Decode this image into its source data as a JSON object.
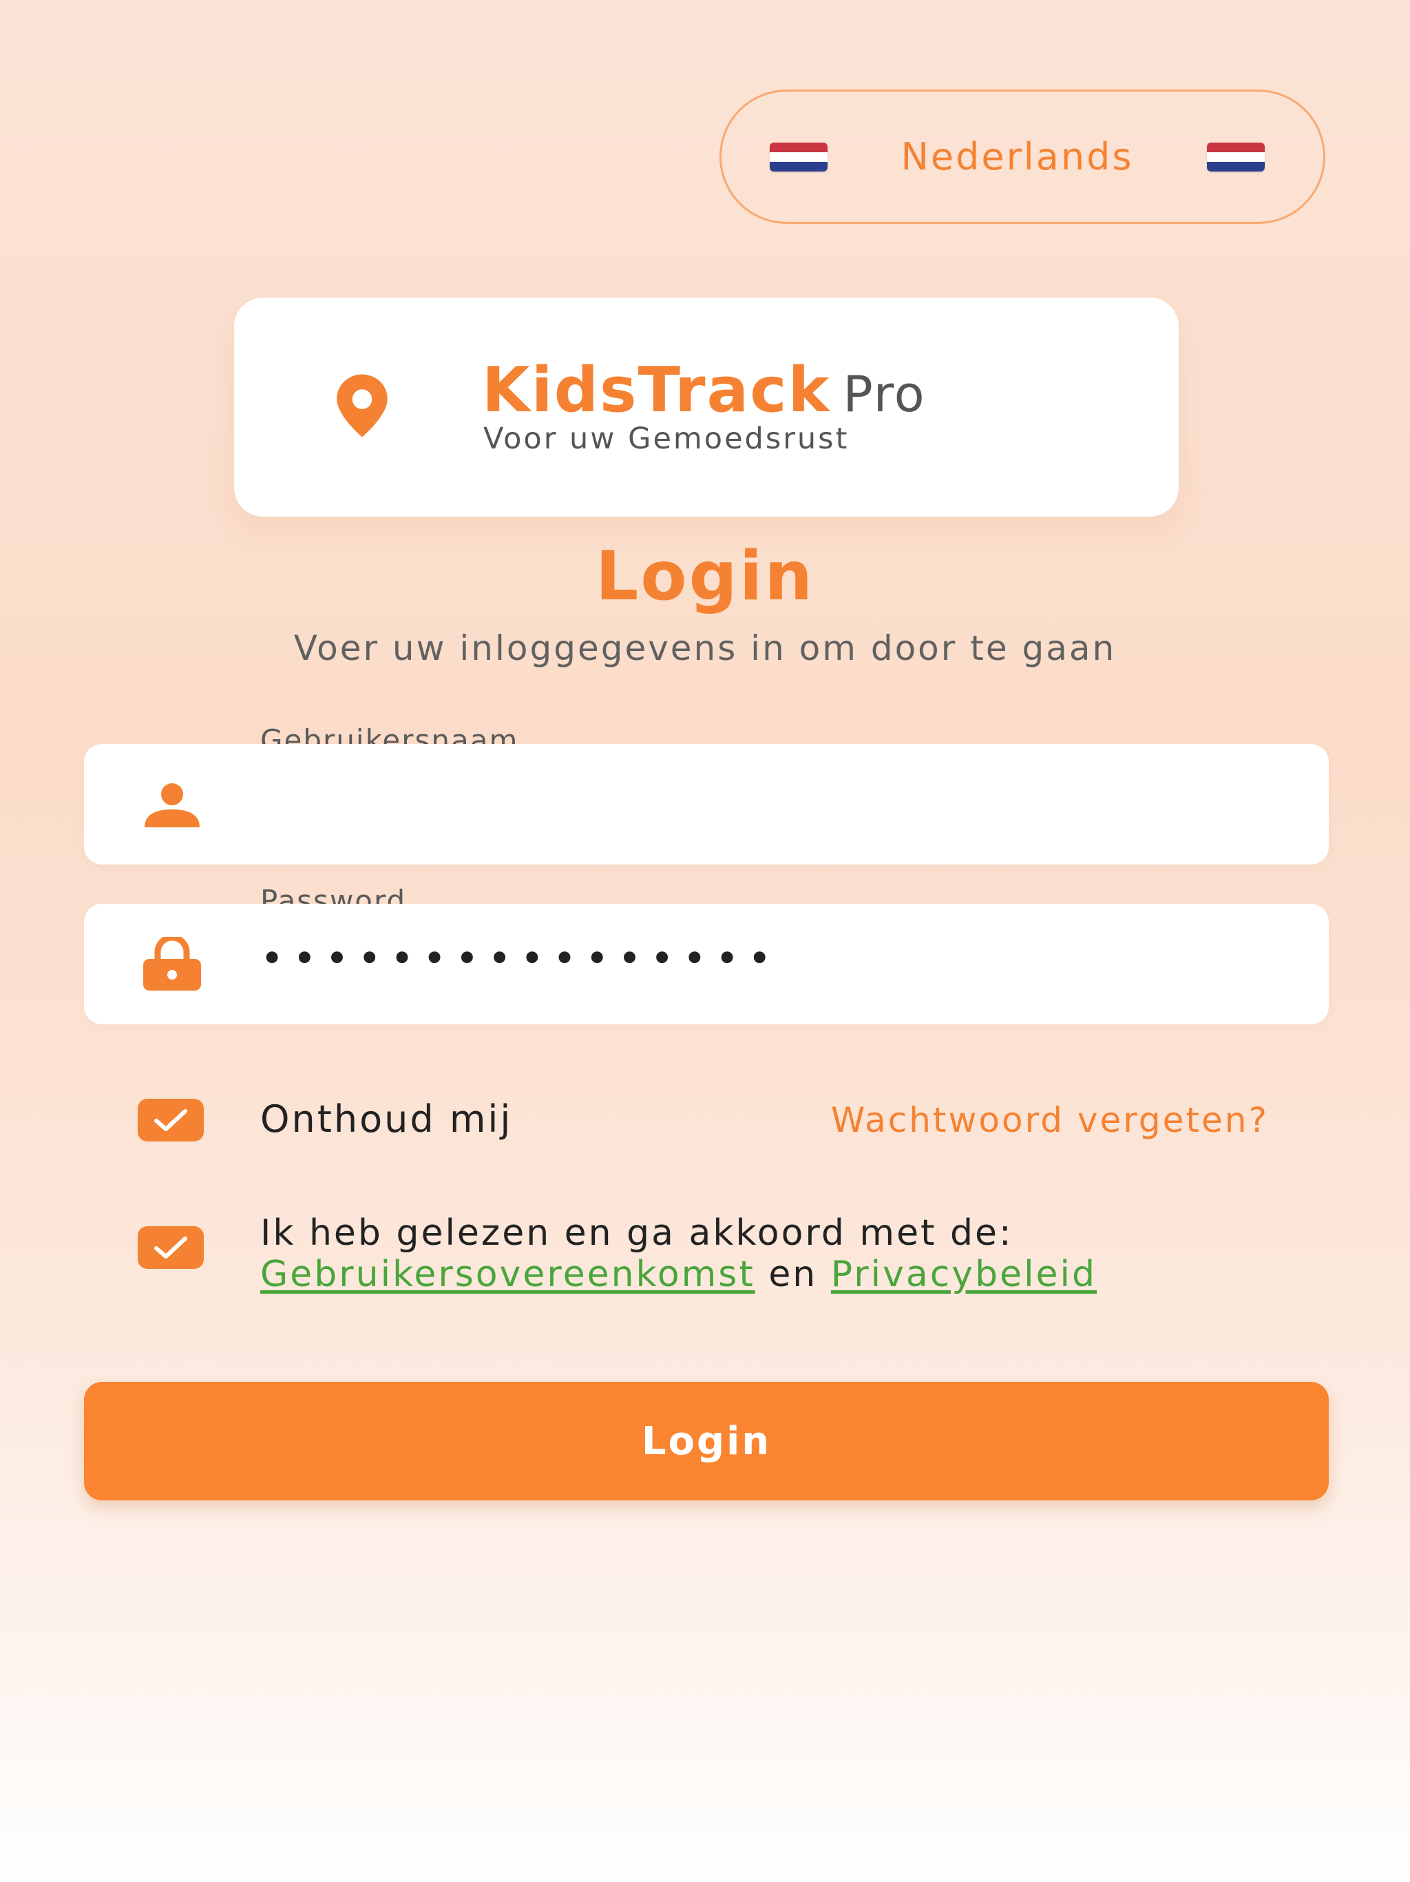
{
  "language": {
    "label": "Nederlands",
    "flag_icon": "netherlands-flag-icon"
  },
  "brand": {
    "name": "KidsTrack",
    "suffix": "Pro",
    "tagline": "Voor uw Gemoedsrust",
    "icon": "location-pin-icon"
  },
  "header": {
    "title": "Login",
    "subtitle": "Voer uw inloggegevens in om door te gaan"
  },
  "form": {
    "username": {
      "label": "Gebruikersnaam",
      "value": "",
      "icon": "user-icon"
    },
    "password": {
      "label": "Password",
      "masked_value": "••••••••••••••••",
      "icon": "lock-icon"
    },
    "remember_me": {
      "label": "Onthoud mij",
      "checked": true
    },
    "forgot_password": "Wachtwoord vergeten?",
    "agreement": {
      "checked": true,
      "prefix": "Ik heb gelezen en ga akkoord met de:",
      "terms_link": "Gebruikersovereenkomst",
      "conjunction": "en",
      "privacy_link": "Privacybeleid"
    },
    "submit_label": "Login"
  },
  "colors": {
    "accent": "#f58232",
    "link_green": "#4aa53b",
    "button": "#fb8430"
  }
}
